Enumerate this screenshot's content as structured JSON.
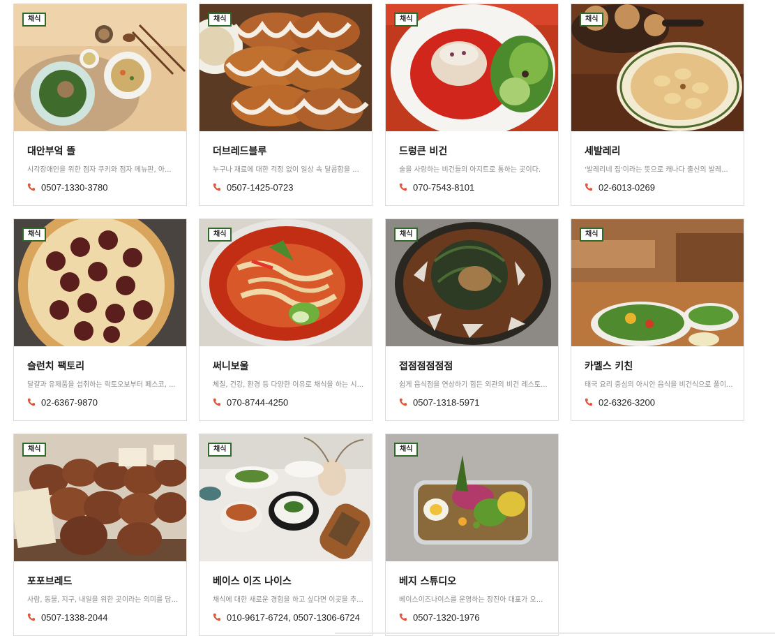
{
  "badge_label": "채식",
  "cards": [
    {
      "title": "대안부엌 뜰",
      "desc": "시각장애인을 위한 점자 쿠키와 점자 메뉴판, 아...",
      "phone": "0507-1330-3780",
      "photo": "korean-bowl-photo"
    },
    {
      "title": "더브레드블루",
      "desc": "누구나 재료에 대한 걱정 없이 일상 속 달콤함을 ...",
      "phone": "0507-1425-0723",
      "photo": "glazed-bread-photo"
    },
    {
      "title": "드렁큰 비건",
      "desc": "술을 사랑하는 비건들의 아지트로 통하는 곳이다.",
      "phone": "070-7543-8101",
      "photo": "tomato-dish-photo"
    },
    {
      "title": "세발레리",
      "desc": "'발레리네 집'이라는 뜻으로 캐나다 출신의 발레...",
      "phone": "02-6013-0269",
      "photo": "gnocchi-photo"
    },
    {
      "title": "슬런치 팩토리",
      "desc": "달걀과 유제품을 섭취하는 락토오보부터 페스코, ...",
      "phone": "02-6367-9870",
      "photo": "pizza-photo"
    },
    {
      "title": "써니보울",
      "desc": "체질, 건강, 환경 등 다양한 이유로 채식을 하는 시...",
      "phone": "070-8744-4250",
      "photo": "noodle-soup-photo"
    },
    {
      "title": "접점점점점점",
      "desc": "쉽게 음식점을 연상하기 힘든 외관의 비건 레스토...",
      "phone": "0507-1318-5971",
      "photo": "greens-bowl-photo"
    },
    {
      "title": "카멜스 키친",
      "desc": "태국 요리 중심의 아시안 음식을 비건식으로 풀이...",
      "phone": "02-6326-3200",
      "photo": "salad-table-photo"
    },
    {
      "title": "포포브레드",
      "desc": "사람, 동물, 지구, 내일을 위한 곳이라는 의미를 담...",
      "phone": "0507-1338-2044",
      "photo": "sourdough-photo"
    },
    {
      "title": "베이스 이즈 나이스",
      "desc": "채식에 대한 새로운 경험을 하고 싶다면 이곳을 추...",
      "phone": "010-9617-6724, 0507-1306-6724",
      "photo": "set-table-photo"
    },
    {
      "title": "베지 스튜디오",
      "desc": "베이스이즈나이스를 운영하는 장진아 대표가 오...",
      "phone": "0507-1320-1976",
      "photo": "lunchbox-photo"
    }
  ],
  "colors": {
    "badge_border": "#2f6a2a",
    "phone_icon": "#e2553a"
  },
  "icons": {
    "phone": "phone-icon"
  }
}
